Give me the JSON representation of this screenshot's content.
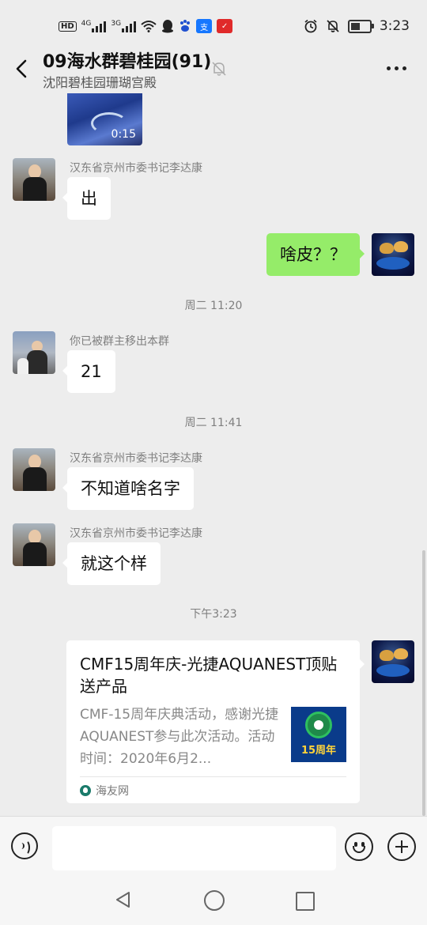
{
  "status_bar": {
    "hd_label": "HD",
    "net1": "4G",
    "net2": "3G",
    "time": "3:23",
    "battery_level": 0.6
  },
  "header": {
    "title": "09海水群碧桂园(91)",
    "subtitle": "沈阳碧桂园珊瑚宫殿"
  },
  "messages": {
    "video_duration": "0:15",
    "m1_sender": "汉东省京州市委书记李达康",
    "m1_text": "出",
    "m2_text": "啥皮？？",
    "ts1": "周二 11:20",
    "m3_sender": "你已被群主移出本群",
    "m3_text": "21",
    "ts2": "周二 11:41",
    "m4_sender": "汉东省京州市委书记李达康",
    "m4_text": "不知道啥名字",
    "m5_sender": "汉东省京州市委书记李达康",
    "m5_text": "就这个样",
    "ts3": "下午3:23"
  },
  "link_card": {
    "title": "CMF15周年庆-光捷AQUANEST顶贴送产品",
    "description": "CMF-15周年庆典活动，感谢光捷AQUANEST参与此次活动。活动时间：2020年6月2...",
    "thumb_label": "15周年",
    "source": "海友网"
  },
  "input_bar": {
    "text_value": ""
  },
  "colors": {
    "background": "#ededed",
    "self_bubble": "#95ec69",
    "other_bubble": "#ffffff"
  }
}
